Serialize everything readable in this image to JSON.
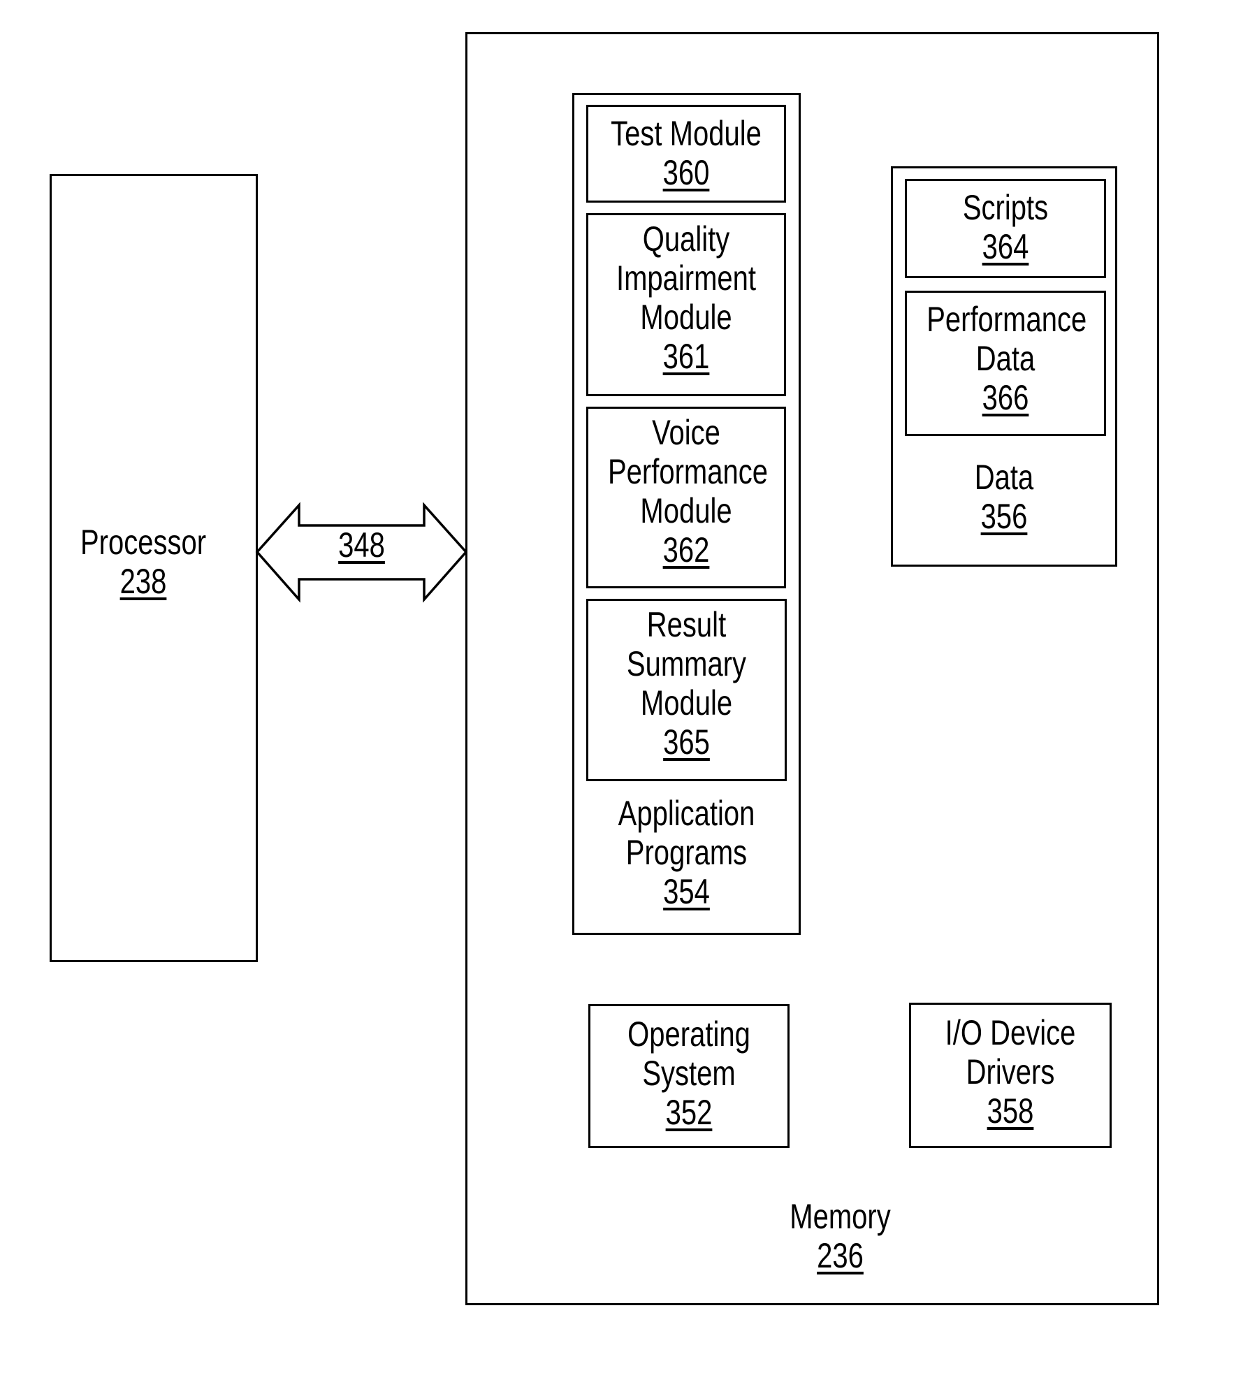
{
  "colors": {
    "stroke": "#000000",
    "background": "#ffffff"
  },
  "processor": {
    "title": "Processor",
    "ref": "238"
  },
  "bus": {
    "ref": "348",
    "shape": "double-headed-arrow"
  },
  "memory": {
    "title": "Memory",
    "ref": "236",
    "application_programs": {
      "title_lines": [
        "Application",
        "Programs"
      ],
      "ref": "354",
      "modules": [
        {
          "lines": [
            "Test Module"
          ],
          "ref": "360"
        },
        {
          "lines": [
            "Quality",
            "Impairment",
            "Module"
          ],
          "ref": "361"
        },
        {
          "lines": [
            "Voice",
            "Performance",
            "Module"
          ],
          "ref": "362"
        },
        {
          "lines": [
            "Result",
            "Summary",
            "Module"
          ],
          "ref": "365"
        }
      ]
    },
    "data": {
      "title": "Data",
      "ref": "356",
      "items": [
        {
          "lines": [
            "Scripts"
          ],
          "ref": "364"
        },
        {
          "lines": [
            "Performance",
            "Data"
          ],
          "ref": "366"
        }
      ]
    },
    "operating_system": {
      "lines": [
        "Operating",
        "System"
      ],
      "ref": "352"
    },
    "io_device_drivers": {
      "lines": [
        "I/O Device",
        "Drivers"
      ],
      "ref": "358"
    }
  }
}
